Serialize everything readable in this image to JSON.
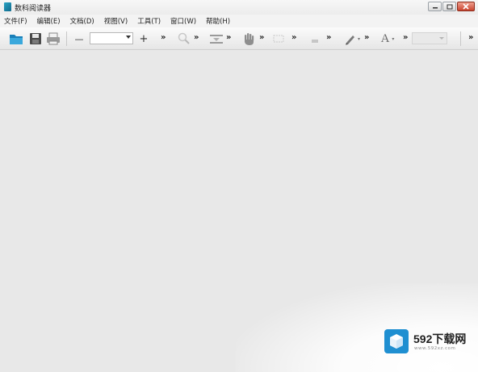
{
  "window": {
    "title": "数科阅读器"
  },
  "menu": [
    {
      "label": "文件(F)"
    },
    {
      "label": "编辑(E)"
    },
    {
      "label": "文档(D)"
    },
    {
      "label": "视图(V)"
    },
    {
      "label": "工具(T)"
    },
    {
      "label": "窗口(W)"
    },
    {
      "label": "帮助(H)"
    }
  ],
  "toolbar": {
    "zoom_minus": "—",
    "zoom_value": "",
    "zoom_plus": "+",
    "overflow": "»",
    "text_tool": "A"
  },
  "watermark": {
    "text": "592下载网",
    "sub": "www.592xz.com"
  },
  "colors": {
    "accent": "#1f8fd1",
    "window_bg": "#e8e8e8"
  }
}
